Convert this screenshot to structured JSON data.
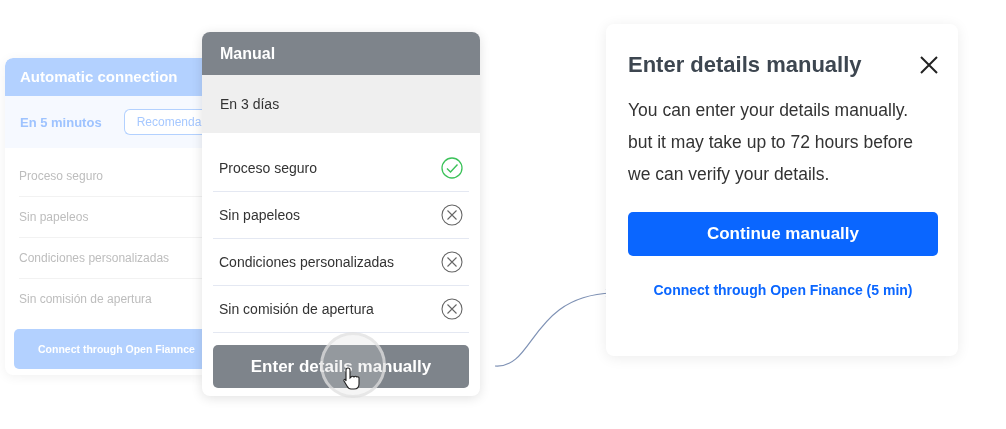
{
  "automatic_card": {
    "title": "Automatic connection",
    "time": "En 5 minutos",
    "badge": "Recomenda",
    "features": [
      "Proceso seguro",
      "Sin papeleos",
      "Condiciones personalizadas",
      "Sin comisión de apertura"
    ],
    "button": "Connect through Open Fiannce"
  },
  "manual_card": {
    "title": "Manual",
    "time": "En 3 días",
    "features": [
      {
        "label": "Proceso seguro",
        "available": true
      },
      {
        "label": "Sin papeleos",
        "available": false
      },
      {
        "label": "Condiciones personalizadas",
        "available": false
      },
      {
        "label": "Sin comisión de apertura",
        "available": false
      }
    ],
    "button": "Enter details manually"
  },
  "dialog": {
    "title": "Enter details manually",
    "body": "You can enter your details manually. but it may take up to 72 hours before we can verify your details.",
    "primary_button": "Continue manually",
    "link": "Connect through Open Finance (5 min)"
  }
}
